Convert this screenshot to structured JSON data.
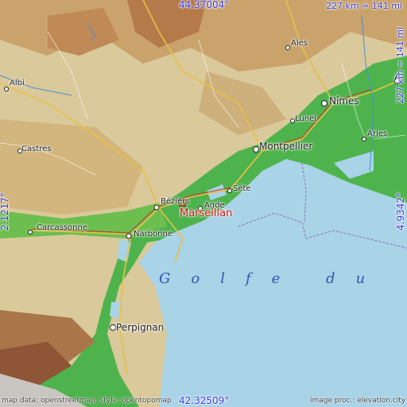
{
  "coords": {
    "top": "44.37004°",
    "bottom": "42.32509°",
    "left": "2.1217°",
    "right": "4.9342°",
    "scale_top": "227 km = 141 mi",
    "scale_right": "227 km = 141 mi"
  },
  "highlight": {
    "name": "Marseillan"
  },
  "places": {
    "albi": "Albi",
    "castres": "Castres",
    "carcassonne": "Carcassonne",
    "narbonne": "Narbonne",
    "beziers": "Béziers",
    "agde": "Agde",
    "sete": "Sète",
    "montpellier": "Montpellier",
    "lunel": "Lunel",
    "nimes": "Nîmes",
    "ales": "Alès",
    "arles": "Arles",
    "avignon": "A",
    "perpignan": "Perpignan"
  },
  "sea": {
    "name": "Golfe du L"
  },
  "credits": {
    "left": "map data: openstreetmap, style: opentopomap",
    "right": "image proc.: elevation.city"
  },
  "colors": {
    "sea": "#a9d3e6",
    "lowland": "#4fb34d",
    "hills": "#d8c89a",
    "highlight": "#d01010",
    "coord": "#3a3adf"
  }
}
